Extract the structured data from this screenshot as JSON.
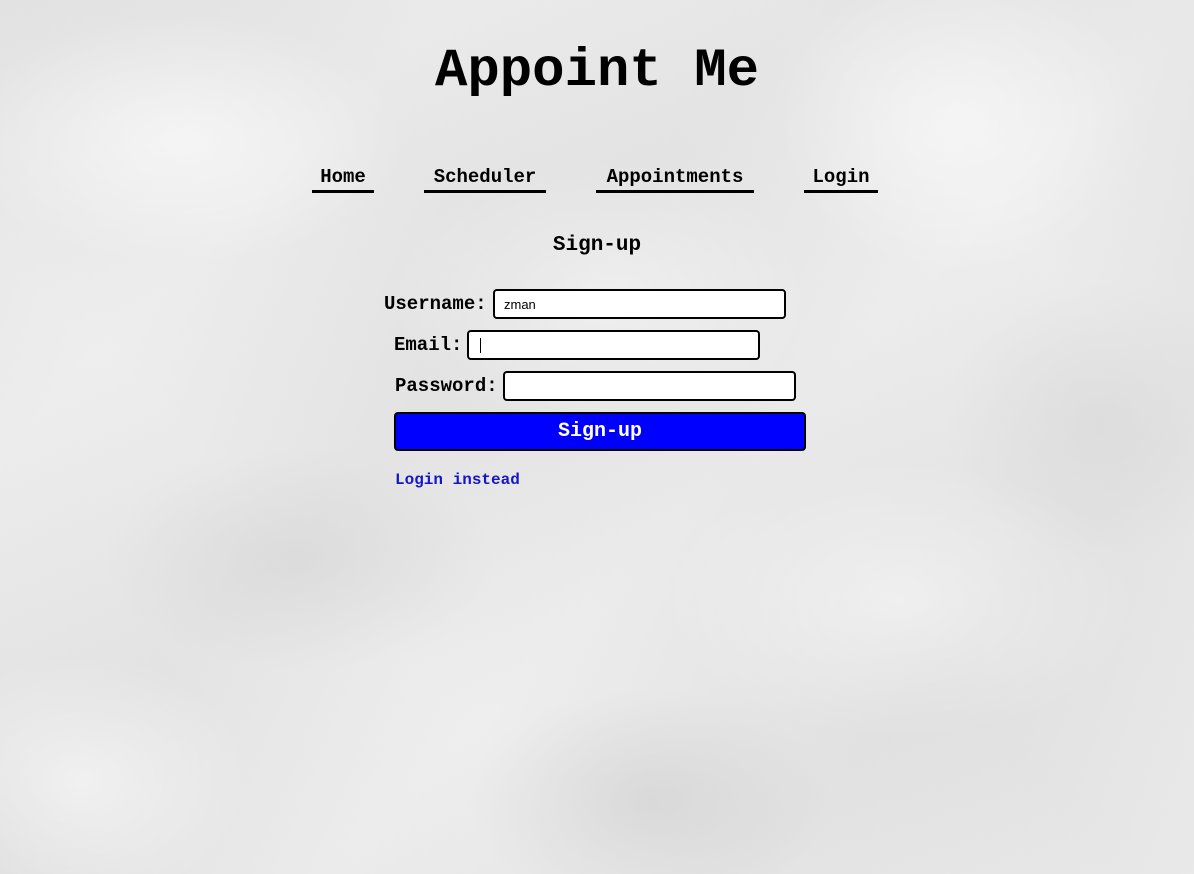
{
  "app": {
    "title": "Appoint Me"
  },
  "nav": {
    "items": [
      {
        "label": "Home"
      },
      {
        "label": "Scheduler"
      },
      {
        "label": "Appointments"
      },
      {
        "label": "Login"
      }
    ]
  },
  "form": {
    "heading": "Sign-up",
    "username": {
      "label": "Username:",
      "value": "zman",
      "placeholder": ""
    },
    "email": {
      "label": "Email:",
      "value": "",
      "placeholder": ""
    },
    "password": {
      "label": "Password:",
      "value": "",
      "placeholder": ""
    },
    "submit_label": "Sign-up",
    "alt_link_label": "Login instead"
  },
  "colors": {
    "primary_button": "#0000ff",
    "link": "#1616c8",
    "text": "#000000"
  }
}
